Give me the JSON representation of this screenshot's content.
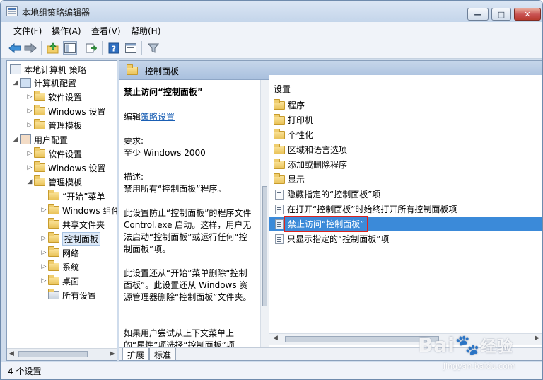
{
  "window": {
    "title": "本地组策略编辑器"
  },
  "menu": [
    "文件(F)",
    "操作(A)",
    "查看(V)",
    "帮助(H)"
  ],
  "tree": {
    "root": "本地计算机 策略",
    "computer": "计算机配置",
    "computer_children": [
      "软件设置",
      "Windows 设置",
      "管理模板"
    ],
    "user": "用户配置",
    "user_children": [
      "软件设置",
      "Windows 设置",
      "管理模板"
    ],
    "admin_children": [
      "“开始”菜单",
      "Windows 组件",
      "共享文件夹",
      "控制面板",
      "网络",
      "系统",
      "桌面",
      "所有设置"
    ]
  },
  "header": {
    "title": "控制面板"
  },
  "description": {
    "title": "禁止访问“控制面板”",
    "edit_prefix": "编辑",
    "edit_link": "策略设置",
    "req_label": "要求:",
    "req_value": "至少 Windows 2000",
    "desc_label": "描述:",
    "desc_value": "禁用所有“控制面板”程序。",
    "p1": "此设置防止“控制面板”的程序文件 Control.exe 启动。这样，用户无法启动“控制面板”或运行任何“控制面板”项。",
    "p2": "此设置还从“开始”菜单删除“控制面板”。此设置还从 Windows 资源管理器删除“控制面板”文件夹。",
    "p3": "如果用户尝试从上下文菜单上的“属性”项选择“控制面板”项"
  },
  "list": {
    "header": "设置",
    "folders": [
      "程序",
      "打印机",
      "个性化",
      "区域和语言选项",
      "添加或删除程序",
      "显示"
    ],
    "policies": [
      "隐藏指定的“控制面板”项",
      "在打开“控制面板”时始终打开所有控制面板项",
      "禁止访问“控制面板”",
      "只显示指定的“控制面板”项"
    ]
  },
  "tabs": [
    "扩展",
    "标准"
  ],
  "status": "4 个设置",
  "watermark": {
    "brand": "Bai",
    "brand2": "经验",
    "url": "jingyan.baidu.com"
  },
  "colors": {
    "selection": "#3b8ad9",
    "highlight_box": "#e0231c"
  }
}
